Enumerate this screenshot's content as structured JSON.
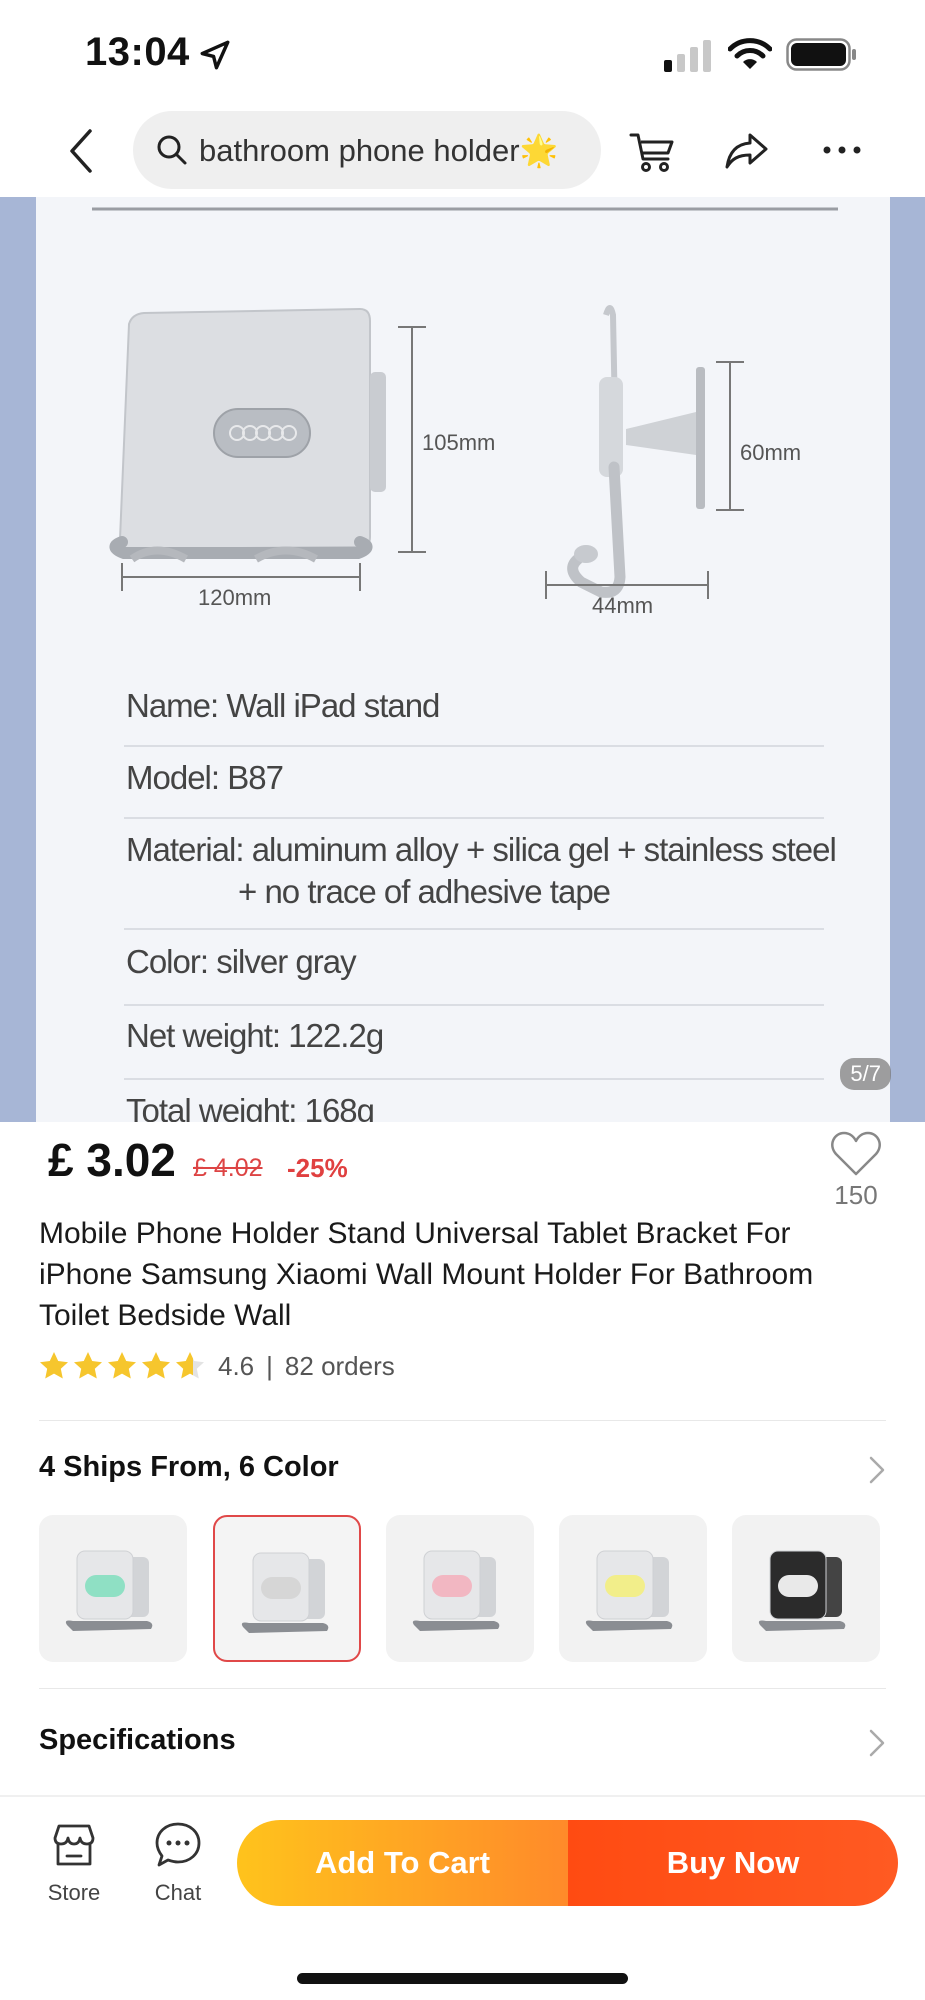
{
  "status_bar": {
    "time": "13:04"
  },
  "search": {
    "query": "bathroom phone holder🌟"
  },
  "hero": {
    "dims": [
      "105mm",
      "120mm",
      "60mm",
      "44mm"
    ],
    "specs": [
      "Name: Wall iPad stand",
      "Model: B87",
      "Material: aluminum alloy + silica gel + stainless steel",
      "+ no trace of adhesive tape",
      "Color: silver gray",
      "Net weight: 122.2g",
      "Total weight: 168g"
    ],
    "pager": "5/7"
  },
  "product": {
    "price": "£ 3.02",
    "old_price": "£ 4.02",
    "discount": "-25%",
    "wishlist_count": "150",
    "title": "Mobile Phone Holder Stand Universal Tablet Bracket For iPhone Samsung Xiaomi Wall Mount Holder For Bathroom Toilet Bedside Wall",
    "rating": "4.6",
    "rating_sep": "|",
    "orders": "82 orders",
    "rating_stars": 4.6
  },
  "variants": {
    "title": "4 Ships From, 6 Color",
    "swatch_colors": [
      "#8fe0c4",
      "#d6d6d6",
      "#f2b7c2",
      "#f2ee8a",
      "#2b2b2b"
    ],
    "selected_index": 1
  },
  "specifications": {
    "title": "Specifications"
  },
  "tab_bar": {
    "store": "Store",
    "chat": "Chat",
    "add_to_cart": "Add To Cart",
    "buy_now": "Buy Now"
  },
  "colors": {
    "accent": "#ff4b12",
    "star": "#f6c62d",
    "discount": "#e04040"
  }
}
